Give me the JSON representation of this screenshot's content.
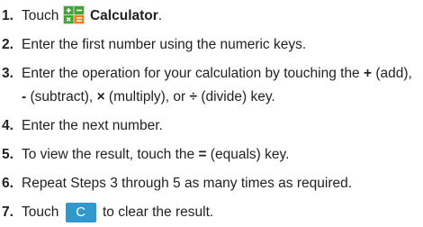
{
  "steps": [
    {
      "num": "1.",
      "before": "Touch ",
      "icon": "calculator-icon",
      "strong": "Calculator",
      "after": "."
    },
    {
      "num": "2.",
      "text": "Enter the first number using the numeric keys."
    },
    {
      "num": "3.",
      "t1": "Enter the operation for your calculation by touching the ",
      "plus": "+",
      "t2": " (add), ",
      "minus": "-",
      "t3": " (subtract), ",
      "times": "×",
      "t4": " (multiply), or ",
      "divide": "÷",
      "t5": " (divide) key."
    },
    {
      "num": "4.",
      "text": "Enter the next number."
    },
    {
      "num": "5.",
      "t1": "To view the result, touch the ",
      "equals": "=",
      "t2": " (equals) key."
    },
    {
      "num": "6.",
      "text": "Repeat Steps 3 through 5 as many times as required."
    },
    {
      "num": "7.",
      "before": "Touch ",
      "key": "C",
      "after": " to clear the result."
    }
  ],
  "colors": {
    "text": "#231f20",
    "key_blue": "#3399cc",
    "icon_green": "#3fa535",
    "icon_orange": "#f0821e"
  }
}
